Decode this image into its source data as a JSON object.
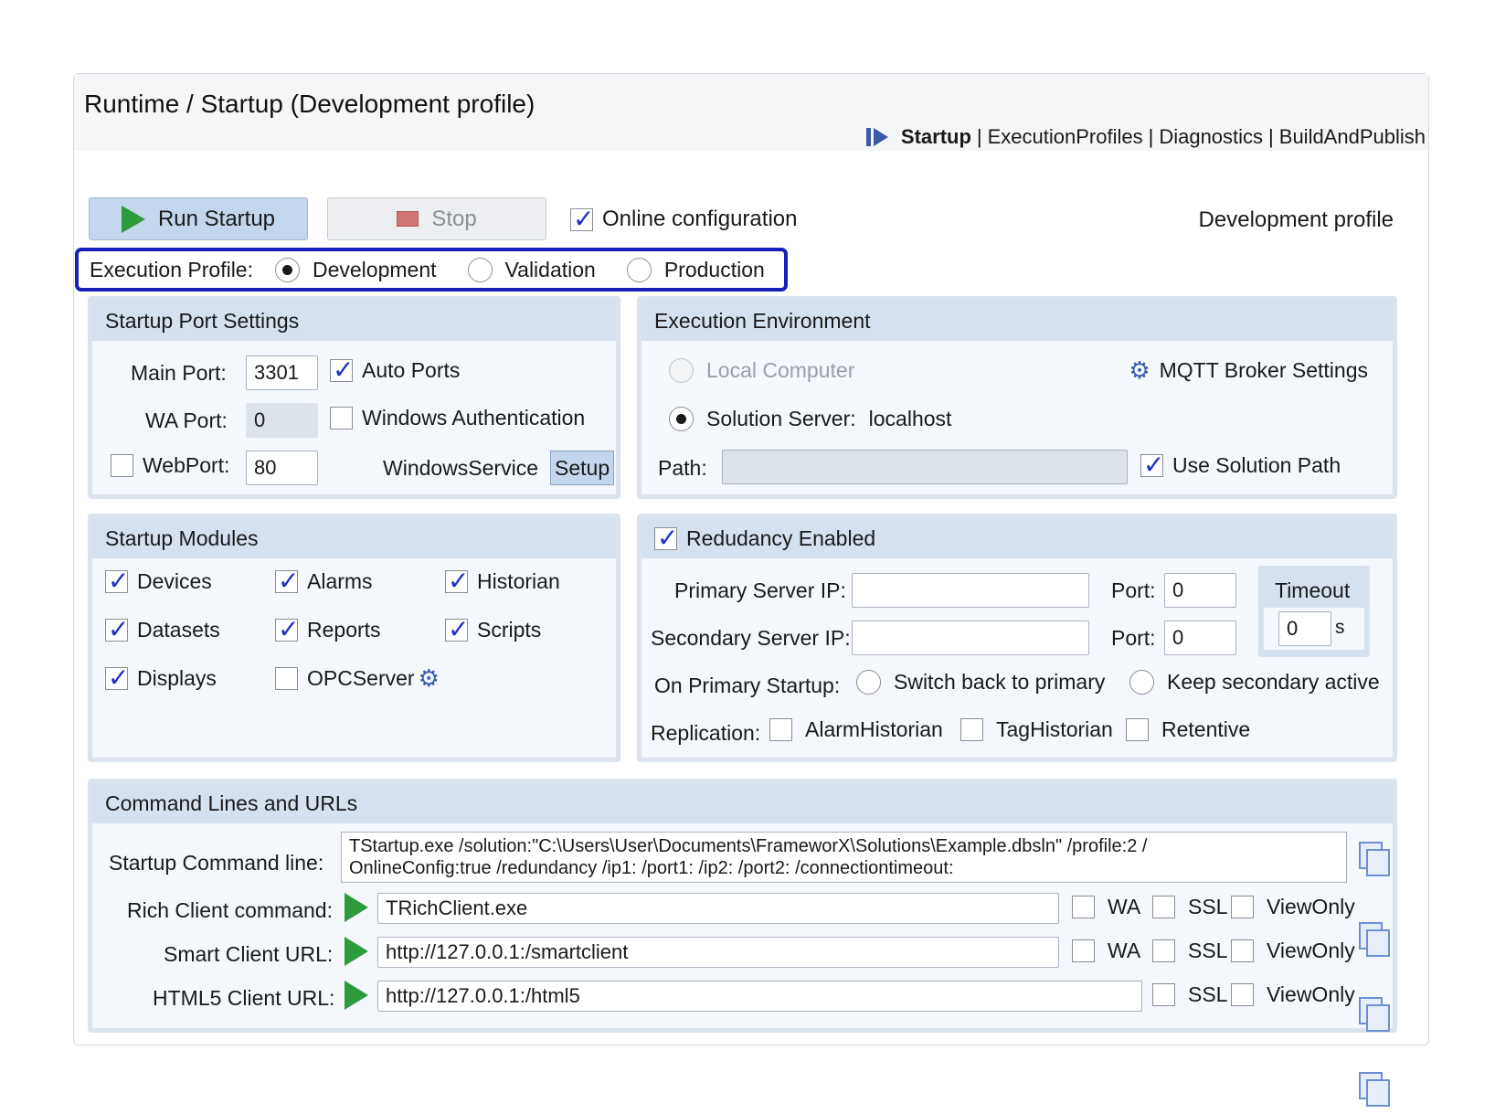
{
  "header": {
    "title": "Runtime / Startup (Development profile)",
    "nav": {
      "active": "Startup",
      "links": [
        "ExecutionProfiles",
        "Diagnostics",
        "BuildAndPublish"
      ],
      "separator": "|"
    }
  },
  "toolbar": {
    "run_label": "Run Startup",
    "stop_label": "Stop",
    "online_config_label": "Online configuration",
    "online_config_checked": true,
    "profile_status": "Development profile"
  },
  "execution_profile": {
    "label": "Execution Profile:",
    "options": [
      "Development",
      "Validation",
      "Production"
    ],
    "selected": "Development"
  },
  "port_settings": {
    "title": "Startup Port Settings",
    "main_port_label": "Main Port:",
    "main_port_value": "3301",
    "auto_ports_label": "Auto Ports",
    "auto_ports_checked": true,
    "wa_port_label": "WA Port:",
    "wa_port_value": "0",
    "windows_auth_label": "Windows Authentication",
    "web_port_label": "WebPort:",
    "web_port_value": "80",
    "windows_service_label": "WindowsService",
    "setup_label": "Setup"
  },
  "environment": {
    "title": "Execution Environment",
    "local_computer_label": "Local Computer",
    "mqtt_label": "MQTT Broker Settings",
    "solution_server_label": "Solution Server:",
    "solution_server_value": "localhost",
    "path_label": "Path:",
    "path_value": "",
    "use_solution_path_label": "Use Solution Path",
    "use_solution_path_checked": true
  },
  "modules": {
    "title": "Startup Modules",
    "items": [
      {
        "label": "Devices",
        "checked": true
      },
      {
        "label": "Alarms",
        "checked": true
      },
      {
        "label": "Historian",
        "checked": true
      },
      {
        "label": "Datasets",
        "checked": true
      },
      {
        "label": "Reports",
        "checked": true
      },
      {
        "label": "Scripts",
        "checked": true
      },
      {
        "label": "Displays",
        "checked": true
      },
      {
        "label": "OPCServer",
        "checked": false
      }
    ]
  },
  "redundancy": {
    "title": "Redudancy Enabled",
    "enabled": true,
    "primary_ip_label": "Primary Server IP:",
    "primary_ip_value": "",
    "secondary_ip_label": "Secondary Server IP:",
    "secondary_ip_value": "",
    "port_label": "Port:",
    "primary_port_value": "0",
    "secondary_port_value": "0",
    "timeout_label": "Timeout",
    "timeout_value": "0",
    "timeout_unit": "s",
    "on_primary_label": "On Primary Startup:",
    "switch_back_label": "Switch back to primary",
    "keep_secondary_label": "Keep secondary active",
    "replication_label": "Replication:",
    "alarm_historian_label": "AlarmHistorian",
    "tag_historian_label": "TagHistorian",
    "retentive_label": "Retentive"
  },
  "commands": {
    "title": "Command Lines and URLs",
    "startup_label": "Startup Command line:",
    "startup_line1": "TStartup.exe /solution:\"C:\\Users\\User\\Documents\\FrameworX\\Solutions\\Example.dbsln\" /profile:2 /",
    "startup_line2": "OnlineConfig:true /redundancy /ip1: /port1: /ip2: /port2: /connectiontimeout:",
    "rich_label": "Rich Client command:",
    "rich_value": "TRichClient.exe",
    "smart_label": "Smart Client URL:",
    "smart_value": "http://127.0.0.1:/smartclient",
    "html5_label": "HTML5 Client URL:",
    "html5_value": "http://127.0.0.1:/html5",
    "wa_label": "WA",
    "ssl_label": "SSL",
    "viewonly_label": "ViewOnly"
  },
  "icons": {
    "run": "play-icon",
    "stop": "stop-icon",
    "gear": "gear-icon",
    "copy": "copy-icon",
    "nav_marker": "nav-marker-icon"
  },
  "colors": {
    "accent": "#1720b8",
    "panel_header": "#d5e1ef",
    "run_button": "#c4d6ec",
    "play_green": "#2e9a3e",
    "check_blue": "#1f2ec9"
  }
}
